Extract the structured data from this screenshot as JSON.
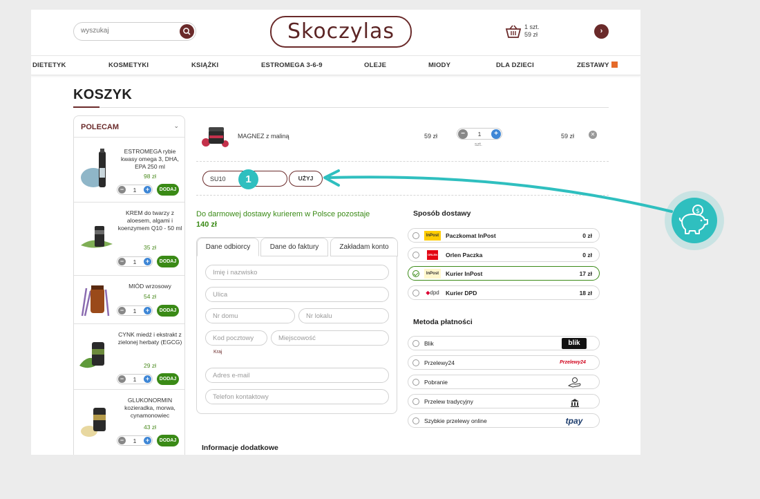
{
  "header": {
    "search_placeholder": "wyszukaj",
    "logo": "Skoczylas",
    "basket_qty": "1 szt.",
    "basket_total": "59 zł"
  },
  "nav": [
    "DIETETYK",
    "KOSMETYKI",
    "KSIĄŻKI",
    "ESTROMEGA 3-6-9",
    "OLEJE",
    "MIODY",
    "DLA DZIECI",
    "ZESTAWY"
  ],
  "page_title": "KOSZYK",
  "sidebar": {
    "title": "POLECAM",
    "add_label": "DODAJ",
    "products": [
      {
        "name": "ESTROMEGA rybie kwasy omega 3, DHA, EPA 250 ml",
        "price": "98 zł",
        "qty": "1"
      },
      {
        "name": "KREM do twarzy z aloesem, algami i koenzymem Q10 - 50 ml",
        "price": "35 zł",
        "qty": "1"
      },
      {
        "name": "MIÓD wrzosowy",
        "price": "54 zł",
        "qty": "1"
      },
      {
        "name": "CYNK miedź i ekstrakt z zielonej herbaty (EGCG)",
        "price": "29 zł",
        "qty": "1"
      },
      {
        "name": "GLUKONORMIN kozieradka, morwa, cynamonowiec",
        "price": "43 zł",
        "qty": "1"
      }
    ]
  },
  "cart": {
    "item_name": "MAGNEZ z maliną",
    "unit_price": "59 zł",
    "qty": "1",
    "unit": "szt.",
    "total": "59 zł"
  },
  "coupon": {
    "value": "SU10",
    "button": "UŻYJ",
    "step": "1"
  },
  "free_shipping": {
    "text": "Do darmowej dostawy kurierem w Polsce pozostaje",
    "amount": "140 zł"
  },
  "form": {
    "tabs": [
      "Dane odbiorcy",
      "Dane do faktury",
      "Zakładam konto"
    ],
    "placeholders": {
      "name": "Imię i nazwisko",
      "street": "Ulica",
      "house": "Nr domu",
      "flat": "Nr lokalu",
      "zip": "Kod pocztowy",
      "city": "Miejscowość",
      "email": "Adres e-mail",
      "phone": "Telefon kontaktowy"
    },
    "country_label": "Kraj"
  },
  "additional_info": "Informacje dodatkowe",
  "shipping": {
    "title": "Sposób dostawy",
    "options": [
      {
        "label": "Paczkomat InPost",
        "price": "0 zł",
        "logo": "InPost",
        "selected": false
      },
      {
        "label": "Orlen Paczka",
        "price": "0 zł",
        "logo": "ORLEN",
        "selected": false
      },
      {
        "label": "Kurier InPost",
        "price": "17 zł",
        "logo": "InPost",
        "selected": true
      },
      {
        "label": "Kurier DPD",
        "price": "18 zł",
        "logo": "dpd",
        "selected": false
      }
    ]
  },
  "payment": {
    "title": "Metoda płatności",
    "options": [
      {
        "label": "Blik",
        "logo": "blik"
      },
      {
        "label": "Przelewy24",
        "logo": "Przelewy24"
      },
      {
        "label": "Pobranie",
        "logo": "hand-coins-icon"
      },
      {
        "label": "Przelew tradycyjny",
        "logo": "bank-icon"
      },
      {
        "label": "Szybkie przelewy online",
        "logo": "tpay"
      }
    ]
  },
  "colors": {
    "brand": "#6a2a2a",
    "green": "#3a8a16",
    "accent_blue": "#3f87d6",
    "annotation": "#2fbfbf"
  }
}
